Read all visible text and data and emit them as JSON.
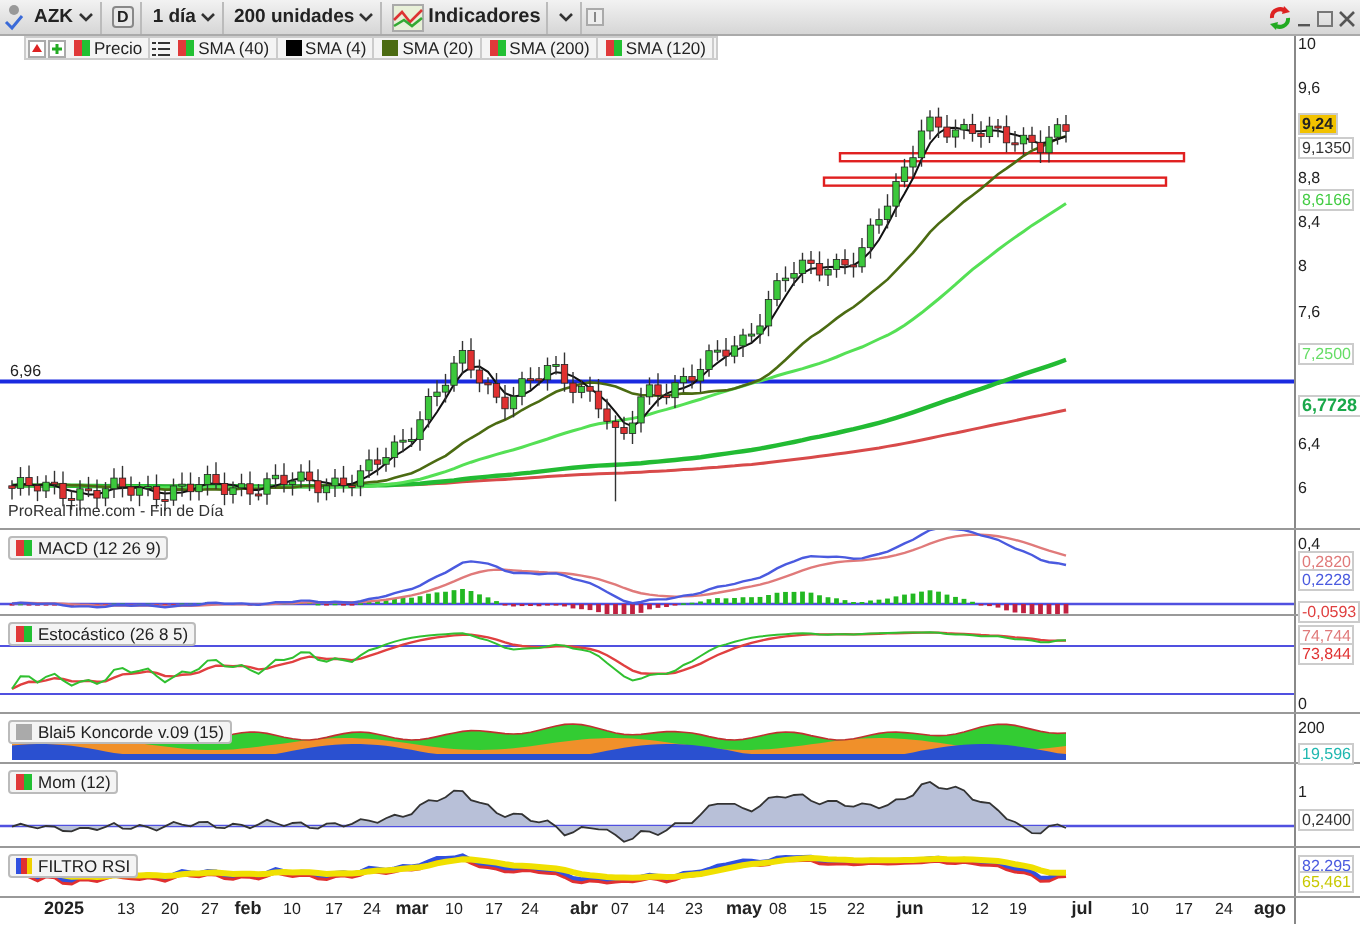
{
  "toolbar": {
    "symbol": "AZK",
    "period": "D",
    "interval": "1 día",
    "units": "200 unidades",
    "indicators": "Indicadores"
  },
  "legend": [
    {
      "label": "Precio",
      "kind": "split"
    },
    {
      "label": "SMA (40)",
      "kind": "split"
    },
    {
      "label": "SMA (4)",
      "kind": "solid",
      "color": "#000000"
    },
    {
      "label": "SMA (20)",
      "kind": "solid",
      "color": "#4b6b12"
    },
    {
      "label": "SMA (200)",
      "kind": "split"
    },
    {
      "label": "SMA (120)",
      "kind": "split"
    }
  ],
  "price_panel": {
    "line_label": "6,96",
    "source": "ProRealTime.com - Fin de Día",
    "axis": [
      {
        "text": "10",
        "kind": "tick"
      },
      {
        "text": "9,6",
        "kind": "tick"
      },
      {
        "text": "9,24",
        "kind": "last",
        "color": "#f2c200"
      },
      {
        "text": "9,1350",
        "kind": "value",
        "color": "#333333"
      },
      {
        "text": "8,8",
        "kind": "tick"
      },
      {
        "text": "8,6166",
        "kind": "value",
        "color": "#44cc44"
      },
      {
        "text": "8,4",
        "kind": "tick"
      },
      {
        "text": "8",
        "kind": "tick"
      },
      {
        "text": "7,6",
        "kind": "tick"
      },
      {
        "text": "7,2500",
        "kind": "value",
        "color": "#66dd66"
      },
      {
        "text": "6,7728",
        "kind": "strong",
        "color": "#1aa84a"
      },
      {
        "text": "6,4",
        "kind": "tick"
      },
      {
        "text": "6",
        "kind": "tick"
      }
    ]
  },
  "indicators": [
    {
      "title": "MACD (12 26 9)",
      "kind": "macd",
      "axis": [
        {
          "text": "0,4",
          "kind": "tick"
        },
        {
          "text": "0,2820",
          "kind": "value",
          "color": "#e07a7a"
        },
        {
          "text": "0,2228",
          "kind": "value",
          "color": "#4a5adf"
        },
        {
          "text": "-0,0593",
          "kind": "value",
          "color": "#e04040"
        }
      ]
    },
    {
      "title": "Estocástico (26 8 5)",
      "kind": "stochastic",
      "axis": [
        {
          "text": "74,744",
          "kind": "value",
          "color": "#e07a7a"
        },
        {
          "text": "73,844",
          "kind": "value",
          "color": "#e03030"
        },
        {
          "text": "0",
          "kind": "tick"
        }
      ]
    },
    {
      "title": "Blai5 Koncorde v.09 (15)",
      "kind": "koncorde",
      "axis": [
        {
          "text": "200",
          "kind": "tick"
        },
        {
          "text": "19,596",
          "kind": "value",
          "color": "#20b8b0"
        }
      ]
    },
    {
      "title": "Mom (12)",
      "kind": "momentum",
      "axis": [
        {
          "text": "1",
          "kind": "tick"
        },
        {
          "text": "0,2400",
          "kind": "value",
          "color": "#333333"
        }
      ]
    },
    {
      "title": "FILTRO RSI",
      "kind": "rsi",
      "axis": [
        {
          "text": "82,295",
          "kind": "value",
          "color": "#4a5adf"
        },
        {
          "text": "65,461",
          "kind": "value",
          "color": "#c8c800"
        }
      ]
    }
  ],
  "date_axis": [
    {
      "text": "2025",
      "major": true
    },
    {
      "text": "13",
      "major": false
    },
    {
      "text": "20",
      "major": false
    },
    {
      "text": "27",
      "major": false
    },
    {
      "text": "feb",
      "major": true
    },
    {
      "text": "10",
      "major": false
    },
    {
      "text": "17",
      "major": false
    },
    {
      "text": "24",
      "major": false
    },
    {
      "text": "mar",
      "major": true
    },
    {
      "text": "10",
      "major": false
    },
    {
      "text": "17",
      "major": false
    },
    {
      "text": "24",
      "major": false
    },
    {
      "text": "abr",
      "major": true
    },
    {
      "text": "07",
      "major": false
    },
    {
      "text": "14",
      "major": false
    },
    {
      "text": "23",
      "major": false
    },
    {
      "text": "may",
      "major": true
    },
    {
      "text": "08",
      "major": false
    },
    {
      "text": "15",
      "major": false
    },
    {
      "text": "22",
      "major": false
    },
    {
      "text": "jun",
      "major": true
    },
    {
      "text": "12",
      "major": false
    },
    {
      "text": "19",
      "major": false
    },
    {
      "text": "jul",
      "major": true
    },
    {
      "text": "10",
      "major": false
    },
    {
      "text": "17",
      "major": false
    },
    {
      "text": "24",
      "major": false
    },
    {
      "text": "ago",
      "major": true
    }
  ]
}
